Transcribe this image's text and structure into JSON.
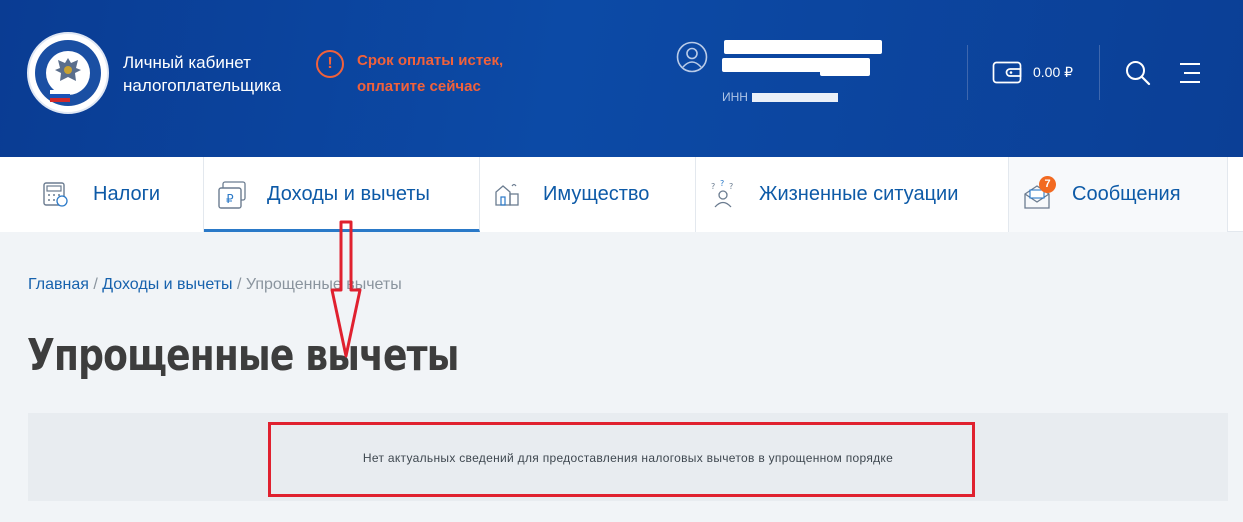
{
  "header": {
    "cabinet_title": "Личный кабинет налогоплательщика",
    "logo_name": "ФНС России emblem",
    "alert": {
      "icon": "exclamation-circle-icon",
      "text": "Срок оплаты истек, оплатите сейчас",
      "color": "#f2613a"
    },
    "user": {
      "icon": "user-circle-icon",
      "inn_label": "ИНН"
    },
    "wallet": {
      "icon": "wallet-icon",
      "balance": "0.00 ₽"
    },
    "search_icon": "search-icon",
    "menu_icon": "menu-icon"
  },
  "nav": {
    "items": [
      {
        "label": "Налоги",
        "icon": "calculator-icon"
      },
      {
        "label": "Доходы и вычеты",
        "icon": "ruble-cards-icon",
        "active": true
      },
      {
        "label": "Имущество",
        "icon": "property-icon"
      },
      {
        "label": "Жизненные ситуации",
        "icon": "person-questions-icon"
      },
      {
        "label": "Сообщения",
        "icon": "envelope-icon",
        "badge": "7"
      }
    ]
  },
  "breadcrumb": {
    "home": "Главная",
    "sep": " / ",
    "section": "Доходы и вычеты",
    "current": "Упрощенные вычеты"
  },
  "page_title": "Упрощенные вычеты",
  "info_message": "Нет актуальных сведений для предоставления налоговых вычетов в упрощенном порядке",
  "colors": {
    "header_bg": "#0c4aa6",
    "accent": "#0d5aa7",
    "annotation": "#e0212f",
    "badge": "#f26a21"
  }
}
